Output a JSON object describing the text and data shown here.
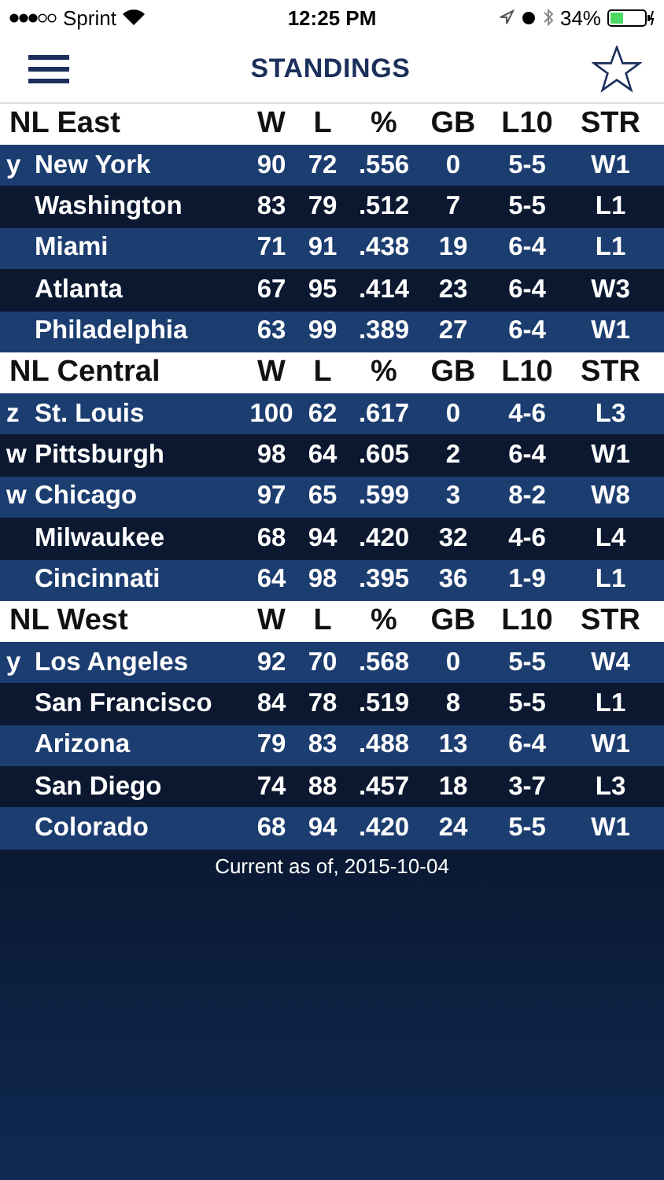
{
  "status_bar": {
    "carrier": "Sprint",
    "time": "12:25 PM",
    "battery": "34%"
  },
  "nav": {
    "title": "STANDINGS"
  },
  "divisions": [
    {
      "name": "NL East",
      "columns": [
        "W",
        "L",
        "%",
        "GB",
        "L10",
        "STR"
      ],
      "teams": [
        {
          "flag": "y",
          "name": "New York",
          "cells": [
            "90",
            "72",
            ".556",
            "0",
            "5-5",
            "W1"
          ]
        },
        {
          "name": "Washington",
          "cells": [
            "83",
            "79",
            ".512",
            "7",
            "5-5",
            "L1"
          ]
        },
        {
          "name": "Miami",
          "cells": [
            "71",
            "91",
            ".438",
            "19",
            "6-4",
            "L1"
          ]
        },
        {
          "name": "Atlanta",
          "cells": [
            "67",
            "95",
            ".414",
            "23",
            "6-4",
            "W3"
          ]
        },
        {
          "name": "Philadelphia",
          "cells": [
            "63",
            "99",
            ".389",
            "27",
            "6-4",
            "W1"
          ]
        }
      ]
    },
    {
      "name": "NL Central",
      "columns": [
        "W",
        "L",
        "%",
        "GB",
        "L10",
        "STR"
      ],
      "teams": [
        {
          "flag": "z",
          "name": "St. Louis",
          "cells": [
            "100",
            "62",
            ".617",
            "0",
            "4-6",
            "L3"
          ]
        },
        {
          "flag": "w",
          "name": "Pittsburgh",
          "cells": [
            "98",
            "64",
            ".605",
            "2",
            "6-4",
            "W1"
          ]
        },
        {
          "flag": "w",
          "name": "Chicago",
          "cells": [
            "97",
            "65",
            ".599",
            "3",
            "8-2",
            "W8"
          ]
        },
        {
          "name": "Milwaukee",
          "cells": [
            "68",
            "94",
            ".420",
            "32",
            "4-6",
            "L4"
          ]
        },
        {
          "name": "Cincinnati",
          "cells": [
            "64",
            "98",
            ".395",
            "36",
            "1-9",
            "L1"
          ]
        }
      ]
    },
    {
      "name": "NL West",
      "columns": [
        "W",
        "L",
        "%",
        "GB",
        "L10",
        "STR"
      ],
      "teams": [
        {
          "flag": "y",
          "name": "Los Angeles",
          "cells": [
            "92",
            "70",
            ".568",
            "0",
            "5-5",
            "W4"
          ]
        },
        {
          "name": "San Francisco",
          "cells": [
            "84",
            "78",
            ".519",
            "8",
            "5-5",
            "L1"
          ]
        },
        {
          "name": "Arizona",
          "cells": [
            "79",
            "83",
            ".488",
            "13",
            "6-4",
            "W1"
          ]
        },
        {
          "name": "San Diego",
          "cells": [
            "74",
            "88",
            ".457",
            "18",
            "3-7",
            "L3"
          ]
        },
        {
          "name": "Colorado",
          "cells": [
            "68",
            "94",
            ".420",
            "24",
            "5-5",
            "W1"
          ]
        }
      ]
    }
  ],
  "footer": "Current as of, 2015-10-04"
}
